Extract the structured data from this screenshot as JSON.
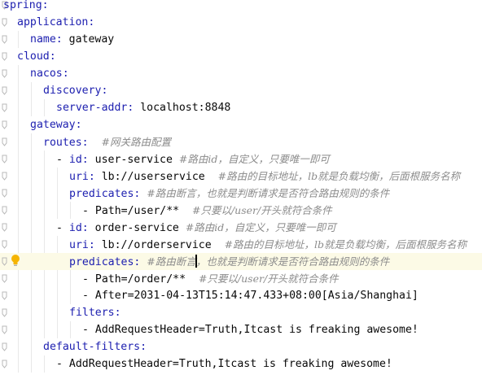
{
  "editor": {
    "lines": [
      {
        "key": "spring:",
        "val": "",
        "comment": ""
      },
      {
        "key": "application:",
        "val": "",
        "comment": ""
      },
      {
        "key": "name:",
        "val": " gateway",
        "comment": ""
      },
      {
        "key": "cloud:",
        "val": "",
        "comment": ""
      },
      {
        "key": "nacos:",
        "val": "",
        "comment": ""
      },
      {
        "key": "discovery:",
        "val": "",
        "comment": ""
      },
      {
        "key": "server-addr:",
        "val": " localhost:8848",
        "comment": ""
      },
      {
        "key": "gateway:",
        "val": "",
        "comment": ""
      },
      {
        "key": "routes:",
        "val": "  ",
        "comment": "#网关路由配置"
      },
      {
        "dash": "- ",
        "key": "id:",
        "val": " user-service ",
        "comment": "#路由id，自定义，只要唯一即可"
      },
      {
        "key": "uri:",
        "val": " lb://userservice  ",
        "comment": "#路由的目标地址，lb就是负载均衡，后面根服务名称"
      },
      {
        "key": "predicates:",
        "val": " ",
        "comment": "#路由断言，也就是判断请求是否符合路由规则的条件"
      },
      {
        "dash": "- ",
        "val": "Path=/user/**  ",
        "comment": "#只要以/user/开头就符合条件"
      },
      {
        "dash": "- ",
        "key": "id:",
        "val": " order-service ",
        "comment": "#路由id，自定义，只要唯一即可"
      },
      {
        "key": "uri:",
        "val": " lb://orderservice  ",
        "comment": "#路由的目标地址，lb就是负载均衡，后面根服务名称"
      },
      {
        "key": "predicates:",
        "val": " ",
        "comment": "#路由断言，也就是判断请求是否符合路由规则的条件"
      },
      {
        "dash": "- ",
        "val": "Path=/order/**  ",
        "comment": "#只要以/user/开头就符合条件"
      },
      {
        "dash": "- ",
        "val": "After=2031-04-13T15:14:47.433+08:00[Asia/Shanghai]",
        "comment": ""
      },
      {
        "key": "filters:",
        "val": "",
        "comment": ""
      },
      {
        "dash": "- ",
        "val": "AddRequestHeader=Truth,Itcast is freaking awesome!",
        "comment": ""
      },
      {
        "key": "default-filters:",
        "val": "",
        "comment": ""
      },
      {
        "dash": "- ",
        "val": "AddRequestHeader=Truth,Itcast is freaking awesome!",
        "comment": ""
      }
    ],
    "highlighted_line": 15,
    "gutter_icon": "lightbulb-icon",
    "colors": {
      "key": "#1e20b0",
      "comment": "#8c8c8c",
      "highlight": "#fcfae6",
      "bulb": "#f5b400"
    }
  }
}
